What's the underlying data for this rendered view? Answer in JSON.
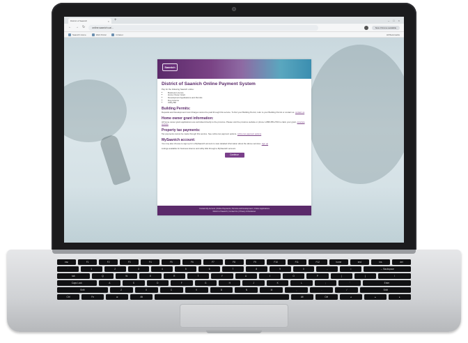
{
  "browser": {
    "tab_title": "District of Saanich",
    "tab_close": "×",
    "new_tab": "+",
    "window_controls": [
      "–",
      "□",
      "×"
    ],
    "nav_back": "←",
    "nav_forward": "→",
    "nav_reload": "↻",
    "url": "online.saanich.ca/...",
    "address_pill": "New Chrome available",
    "bookmarks": [
      "Saanich Home",
      "Web Portal",
      "Intranet"
    ],
    "bookmarks_right": "All Bookmarks"
  },
  "page": {
    "logo": "Saanich",
    "title": "District of Saanich Online Payment System",
    "intro": "Pay for the following Saanich online:",
    "intro_items": [
      "Business Licence",
      "Home Owner Grant",
      "Development Applications and Permits",
      "Dog Licence",
      "Utility Bill"
    ],
    "sections": [
      {
        "heading": "Building Permits:",
        "text": "Deposits and Development Cost Charges cannot be paid through this service. To find your Building Permit, refer to your Building Permit or contact us.",
        "link": "contact us"
      },
      {
        "heading": "Home owner grant information:",
        "text": "All home owner grant applications are submitted directly to the province. Please visit the province website or phone 1-888-355-2700 to claim your grant.",
        "link": "province website"
      },
      {
        "heading": "Property tax payments:",
        "text": "Tax payments cannot be made through this service. See online tax payment options.",
        "link": "online tax payment options"
      },
      {
        "heading": "MySaanich account:",
        "text": "You may also choose to sign up for a MySaanich account to view detailed information about the above services.",
        "link": "sign up"
      }
    ],
    "note": "Listings available for business licence and utility bills through a MySaanich account.",
    "continue_label": "Continue",
    "footer_line1": "Contact My Account | Online Payments | Permits and Development | Online Applications",
    "footer_line2": "District of Saanich | Contact Us | Privacy & Disclaimer"
  },
  "keyboard": {
    "rows": [
      [
        "esc",
        "F1",
        "F2",
        "F3",
        "F4",
        "F5",
        "F6",
        "F7",
        "F8",
        "F9",
        "F10",
        "F11",
        "F12",
        "home",
        "end",
        "ins",
        "del"
      ],
      [
        "`",
        "1",
        "2",
        "3",
        "4",
        "5",
        "6",
        "7",
        "8",
        "9",
        "0",
        "-",
        "=",
        "← Backspace"
      ],
      [
        "tab",
        "Q",
        "W",
        "E",
        "R",
        "T",
        "Y",
        "U",
        "I",
        "O",
        "P",
        "[",
        "]",
        "\\"
      ],
      [
        "Caps Lock",
        "A",
        "S",
        "D",
        "F",
        "G",
        "H",
        "J",
        "K",
        "L",
        ";",
        "'",
        "Enter"
      ],
      [
        "Shift",
        "Z",
        "X",
        "C",
        "V",
        "B",
        "N",
        "M",
        ",",
        ".",
        "/",
        "Shift"
      ],
      [
        "Ctrl",
        "Fn",
        "⊞",
        "Alt",
        "",
        "Alt",
        "Ctrl",
        "◂",
        "▴",
        "▸"
      ]
    ]
  }
}
